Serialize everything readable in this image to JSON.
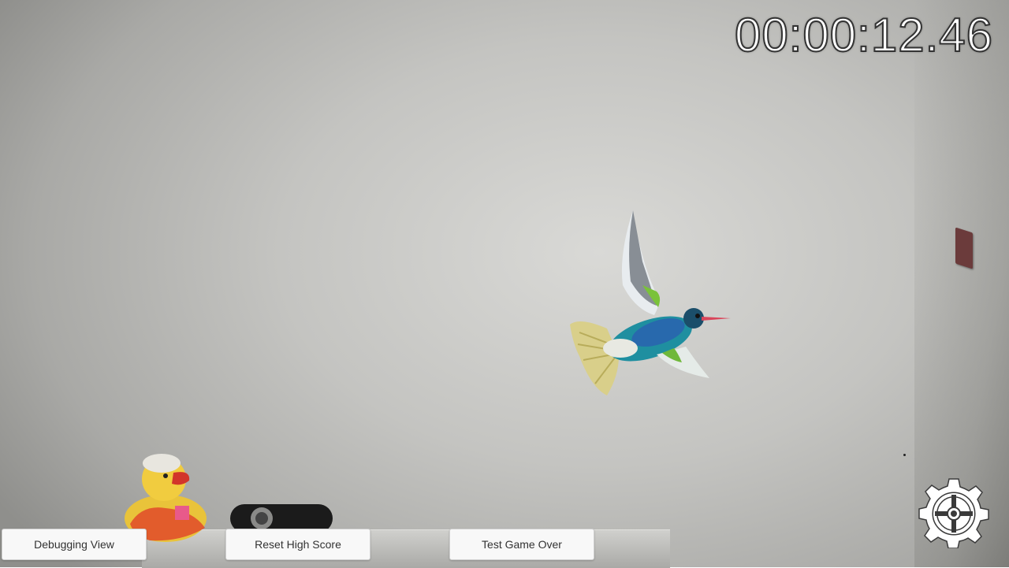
{
  "hud": {
    "timer": "00:00:12.46"
  },
  "buttons": {
    "debugging_view": "Debugging View",
    "reset_high_score": "Reset High Score",
    "test_game_over": "Test Game Over"
  },
  "icons": {
    "settings": "gear-icon"
  },
  "colors": {
    "button_bg": "#f8f8f8",
    "timer_text": "#ffffff"
  }
}
